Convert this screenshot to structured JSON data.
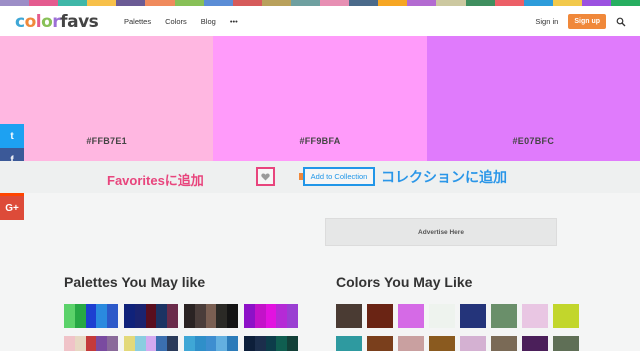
{
  "topstrip_colors": [
    "#9c8ec7",
    "#e45b8f",
    "#3fb7a8",
    "#f7c04a",
    "#6b5b95",
    "#f08a5d",
    "#88c057",
    "#5b8dd6",
    "#d65b5b",
    "#b9a15c",
    "#6fa0a0",
    "#e78fb3",
    "#4b6a8a",
    "#f6a623",
    "#b36bd1",
    "#ccc8a0",
    "#3f8f5f",
    "#ec5f67",
    "#2d9cdb",
    "#f2c94c",
    "#9b51e0",
    "#27ae60"
  ],
  "navbar": {
    "logo_letters": [
      {
        "ch": "c",
        "color": "#3fa7d6"
      },
      {
        "ch": "o",
        "color": "#f0883a"
      },
      {
        "ch": "l",
        "color": "#e45b8f"
      },
      {
        "ch": "o",
        "color": "#88c057"
      },
      {
        "ch": "r",
        "color": "#9c6fd6"
      },
      {
        "ch": "f",
        "color": "#444444"
      },
      {
        "ch": "a",
        "color": "#444444"
      },
      {
        "ch": "v",
        "color": "#444444"
      },
      {
        "ch": "s",
        "color": "#444444"
      }
    ],
    "links": [
      "Palettes",
      "Colors",
      "Blog",
      "•••"
    ],
    "signin": "Sign in",
    "signup": "Sign up"
  },
  "swatches": [
    {
      "hex": "#FFB7E1",
      "color": "#ffb7e1"
    },
    {
      "hex": "#FF9BFA",
      "color": "#ff9bfa"
    },
    {
      "hex": "#E07BFC",
      "color": "#e07bfc"
    }
  ],
  "share": [
    {
      "icon": "twitter-icon",
      "glyph": "t",
      "color": "#1da1f2"
    },
    {
      "icon": "facebook-icon",
      "glyph": "f",
      "color": "#3b5998"
    },
    {
      "icon": "reddit-icon",
      "glyph": "●",
      "color": "#ff4500"
    },
    {
      "icon": "google-plus-icon",
      "glyph": "G+",
      "color": "#dd4b39"
    }
  ],
  "actions": {
    "favorites_annotation": "Favoritesに追加",
    "add_to_collection": "Add to Collection",
    "collection_annotation": "コレクションに追加"
  },
  "ad": "Advertise Here",
  "palettes_heading": "Palettes You May like",
  "colors_heading": "Colors You May Like",
  "palettes": [
    [
      [
        "#5bd26a",
        "#27a845",
        "#1d3fd1",
        "#2a8adf",
        "#2c59c9"
      ],
      [
        "#10227a",
        "#1a2370",
        "#5a0e1e",
        "#1c3363",
        "#6a2b4a"
      ],
      [
        "#2a2323",
        "#4a3d3a",
        "#7a5f52",
        "#2b2a26",
        "#141414"
      ],
      [
        "#8d11c7",
        "#c312c9",
        "#e212e0",
        "#b52ad6",
        "#9a3fd2"
      ]
    ],
    [
      [
        "#f0c3c8",
        "#e7d8c3",
        "#c43a3a",
        "#7a4ba0",
        "#8a6a9a"
      ],
      [
        "#e3d97a",
        "#8acde0",
        "#d4aaf0",
        "#3b6fb0",
        "#2a3a5a"
      ],
      [
        "#3fa7d6",
        "#2f8fc9",
        "#3e8ed0",
        "#63b0e0",
        "#2b7bb9"
      ],
      [
        "#0d1f3a",
        "#1b2e4c",
        "#0c3d4a",
        "#0f5e50",
        "#124038"
      ]
    ]
  ],
  "colors": [
    [
      "#4a3b33",
      "#6a2414",
      "#d56ae6",
      "#eef3ee",
      "#24347a",
      "#6a8f6a",
      "#e9c6e3",
      "#c2d62c"
    ],
    [
      "#2e9aa0",
      "#7a3f1c",
      "#c9a0a0",
      "#8a5a1f",
      "#d4b1d2",
      "#7a6a56",
      "#4b1f5a",
      "#5f6f56"
    ]
  ]
}
